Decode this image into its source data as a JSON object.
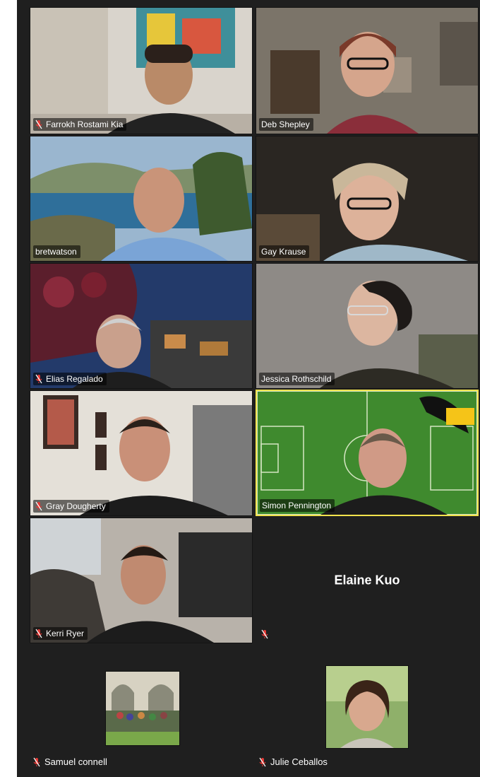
{
  "meeting": {
    "participants": [
      {
        "name": "Farrokh Rostami Kia",
        "muted": true
      },
      {
        "name": "Deb Shepley",
        "muted": false
      },
      {
        "name": "bretwatson",
        "muted": false
      },
      {
        "name": "Gay Krause",
        "muted": false
      },
      {
        "name": "Elias Regalado",
        "muted": true
      },
      {
        "name": "Jessica Rothschild",
        "muted": false
      },
      {
        "name": "Gray Dougherty",
        "muted": true
      },
      {
        "name": "Simon Pennington",
        "muted": false,
        "active_speaker": true
      },
      {
        "name": "Kerri Ryer",
        "muted": true
      },
      {
        "name": "Elaine Kuo",
        "muted": true,
        "video_off": true
      },
      {
        "name": "Samuel connell",
        "muted": true
      },
      {
        "name": "Julie Ceballos",
        "muted": true
      }
    ]
  },
  "colors": {
    "background": "#1f1f1f",
    "active_border": "#f3e34c",
    "muted_icon": "#e53935"
  }
}
